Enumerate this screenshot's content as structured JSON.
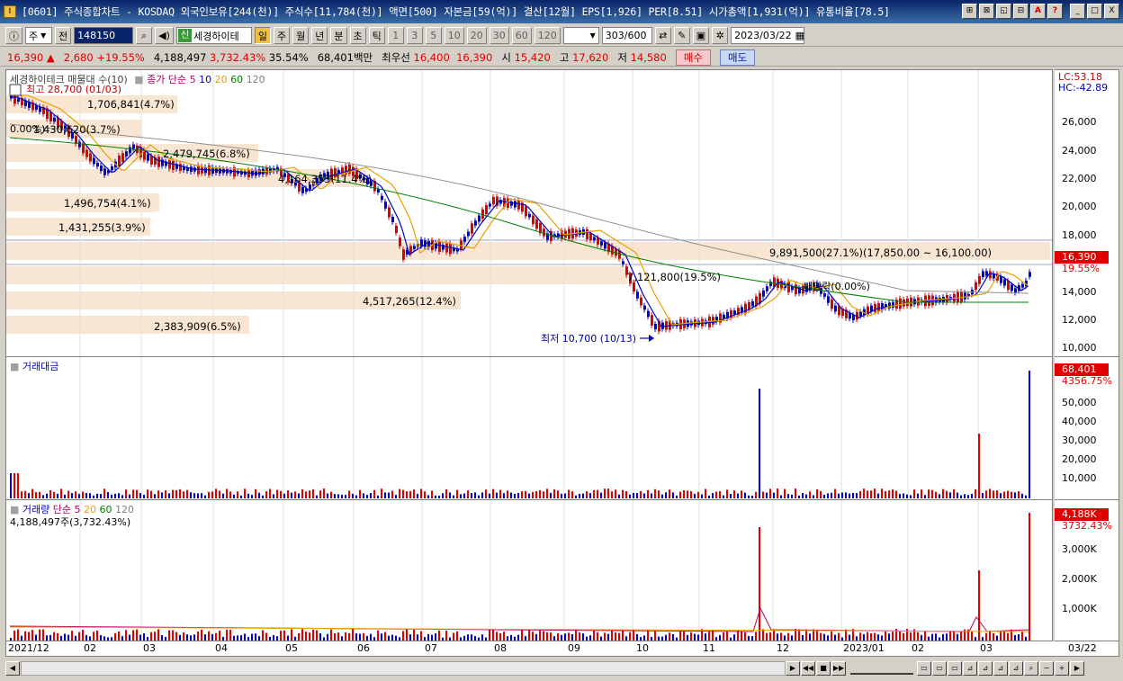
{
  "window": {
    "title": "[0601] 주식종합차트 - KOSDAQ 외국인보유[244(천)] 주식수[11,784(천)] 액면[500] 자본금[59(억)] 결산[12월] EPS[1,926] PER[8.51] 시가총액[1,931(억)] 유통비율[78.5]",
    "app_icon": "I",
    "buttons": [
      "⊞",
      "⊠",
      "◱",
      "⊟",
      "A",
      "?",
      "_",
      "□",
      "X"
    ]
  },
  "toolbar": {
    "period_select": "주",
    "prev_label": "전",
    "code_input": "148150",
    "speaker_icon": "speaker-icon",
    "stock_tag": "신",
    "stock_name": "세경하이테",
    "periods": [
      "일",
      "주",
      "월",
      "년",
      "분",
      "초",
      "틱"
    ],
    "active_period": "일",
    "numbers": [
      "1",
      "3",
      "5",
      "10",
      "20",
      "30",
      "60",
      "120"
    ],
    "count_display": "303",
    "count_total": "/600",
    "date_value": "2023/03/22"
  },
  "quote": {
    "price": "16,390",
    "arrow": "▲",
    "change": "2,680",
    "change_pct": "+19.55%",
    "volume": "4,188,497",
    "volume_pct": "3,732.43%",
    "ratio": "35.54%",
    "amount": "68,401백만",
    "best_label": "최우선",
    "best_ask": "16,400",
    "best_bid": "16,390",
    "open_label": "시",
    "open": "15,420",
    "high_label": "고",
    "high": "17,620",
    "low_label": "저",
    "low": "14,580",
    "buy_label": "매수",
    "sell_label": "매도"
  },
  "price_panel": {
    "legend_title": "세경하이테크 매물대 수(10)",
    "legend_ma_label": "종가 단순",
    "legend_ma": [
      "5",
      "10",
      "20",
      "60",
      "120"
    ],
    "high_label": "최고 28,700 (01/03)",
    "low_label": "최저 10,700 (10/13)",
    "start_label": "0.00%)",
    "event_label": "배당락(0.00%)",
    "lc": "LC:53.18",
    "hc": "HC:-42.89",
    "y_ticks": [
      "26,000",
      "24,000",
      "22,000",
      "20,000",
      "18,000",
      "16,000",
      "14,000",
      "12,000",
      "10,000"
    ],
    "current_tag": "16,390",
    "current_pct": "19.55%",
    "volume_profile": [
      {
        "label": "1,706,841(4.7%)"
      },
      {
        "label": "1,430,620(3.7%)"
      },
      {
        "label": "2,479,745(6.8%)"
      },
      {
        "label": "4,164,353(11.4%)"
      },
      {
        "label": "1,496,754(4.1%)"
      },
      {
        "label": "1,431,255(3.9%)"
      },
      {
        "label": "9,891,500(27.1%)(17,850.00 ~ 16,100.00)"
      },
      {
        "label": "7,121,800(19.5%)"
      },
      {
        "label": "4,517,265(12.4%)"
      },
      {
        "label": "2,383,909(6.5%)"
      }
    ]
  },
  "amount_panel": {
    "title": "거래대금",
    "y_ticks": [
      "50,000",
      "40,000",
      "30,000",
      "20,000",
      "10,000"
    ],
    "current_tag": "68,401",
    "current_pct": "4356.75%"
  },
  "volume_panel": {
    "title": "거래량",
    "ma_label": "단순",
    "ma": [
      "5",
      "20",
      "60",
      "120"
    ],
    "current_text": "4,188,497주(3,732.43%)",
    "y_ticks": [
      "3,000K",
      "2,000K",
      "1,000K"
    ],
    "current_tag": "4,188K",
    "current_pct": "3732.43%"
  },
  "x_axis": {
    "labels": [
      "2021/12",
      "02",
      "03",
      "04",
      "05",
      "06",
      "07",
      "08",
      "09",
      "10",
      "11",
      "12",
      "2023/01",
      "02",
      "03"
    ],
    "right_label": "03/22"
  },
  "colors": {
    "up": "#e00000",
    "down": "#0000e0",
    "ma5": "#0000c0",
    "ma20": "#e8a000",
    "ma60": "#008000",
    "ma120": "#808080",
    "profile": "#f8e6d2"
  }
}
